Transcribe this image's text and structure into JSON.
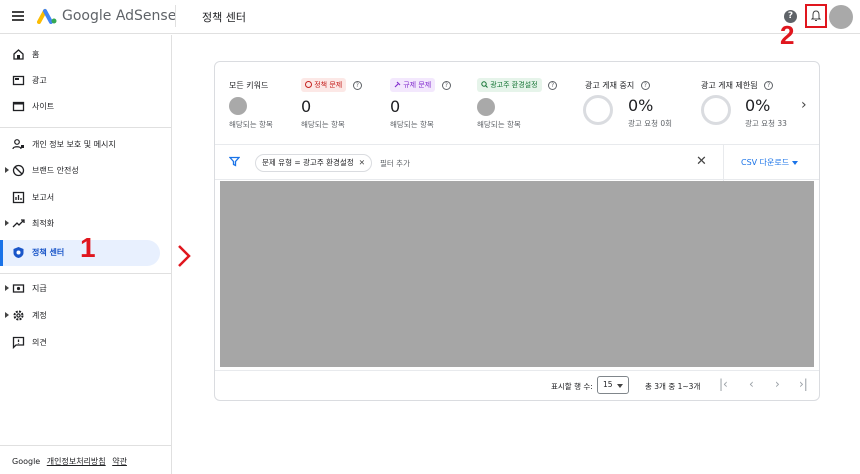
{
  "header": {
    "brand_google": "Google",
    "brand_product": "AdSense",
    "title": "정책 센터",
    "help_glyph": "?"
  },
  "annotations": {
    "one": "1",
    "two": "2"
  },
  "sidebar": {
    "items": [
      {
        "label": "홈",
        "icon": "home-icon"
      },
      {
        "label": "광고",
        "icon": "ads-icon"
      },
      {
        "label": "사이트",
        "icon": "sites-icon"
      },
      {
        "label": "개인 정보 보호 및 메시지",
        "icon": "privacy-icon"
      },
      {
        "label": "브랜드 안전성",
        "icon": "block-icon"
      },
      {
        "label": "보고서",
        "icon": "reports-icon"
      },
      {
        "label": "최적화",
        "icon": "trend-icon"
      },
      {
        "label": "정책 센터",
        "icon": "shield-icon"
      },
      {
        "label": "지급",
        "icon": "payments-icon"
      },
      {
        "label": "계정",
        "icon": "gear-icon"
      },
      {
        "label": "의견",
        "icon": "feedback-icon"
      }
    ],
    "footer": {
      "google": "Google",
      "privacy": "개인정보처리방침",
      "terms": "약관"
    }
  },
  "summary": {
    "all_keywords": {
      "title": "모든 키워드",
      "sub": "해당되는 항목"
    },
    "policy": {
      "chip": "정책 문제",
      "value": "0",
      "sub": "해당되는 항목"
    },
    "regulation": {
      "chip": "규제 문제",
      "value": "0",
      "sub": "해당되는 항목"
    },
    "ad_settings": {
      "chip": "광고주 환경설정",
      "sub": "해당되는 항목"
    },
    "ad_stopped": {
      "title": "광고 게재 중지",
      "value": "0%",
      "sub": "광고 요청 0회"
    },
    "ad_limited": {
      "title": "광고 게재 제한됨",
      "value": "0%",
      "sub": "광고 요청 33"
    },
    "help_glyph": "?",
    "next_glyph": "›"
  },
  "filter": {
    "chip": "문제 유형 = 광고주 환경설정",
    "chip_close": "✕",
    "add_placeholder": "필터 추가",
    "close": "✕",
    "csv": "CSV 다운로드"
  },
  "pager": {
    "rows_label": "표시할 행 수:",
    "rows_value": "15",
    "range": "총 3개 중 1~3개",
    "first": "|‹",
    "prev": "‹",
    "next": "›",
    "last": "›|"
  },
  "colors": {
    "accent": "#1a73e8",
    "annotation": "#e0161e",
    "placeholder_block": "#a6a6a6"
  }
}
